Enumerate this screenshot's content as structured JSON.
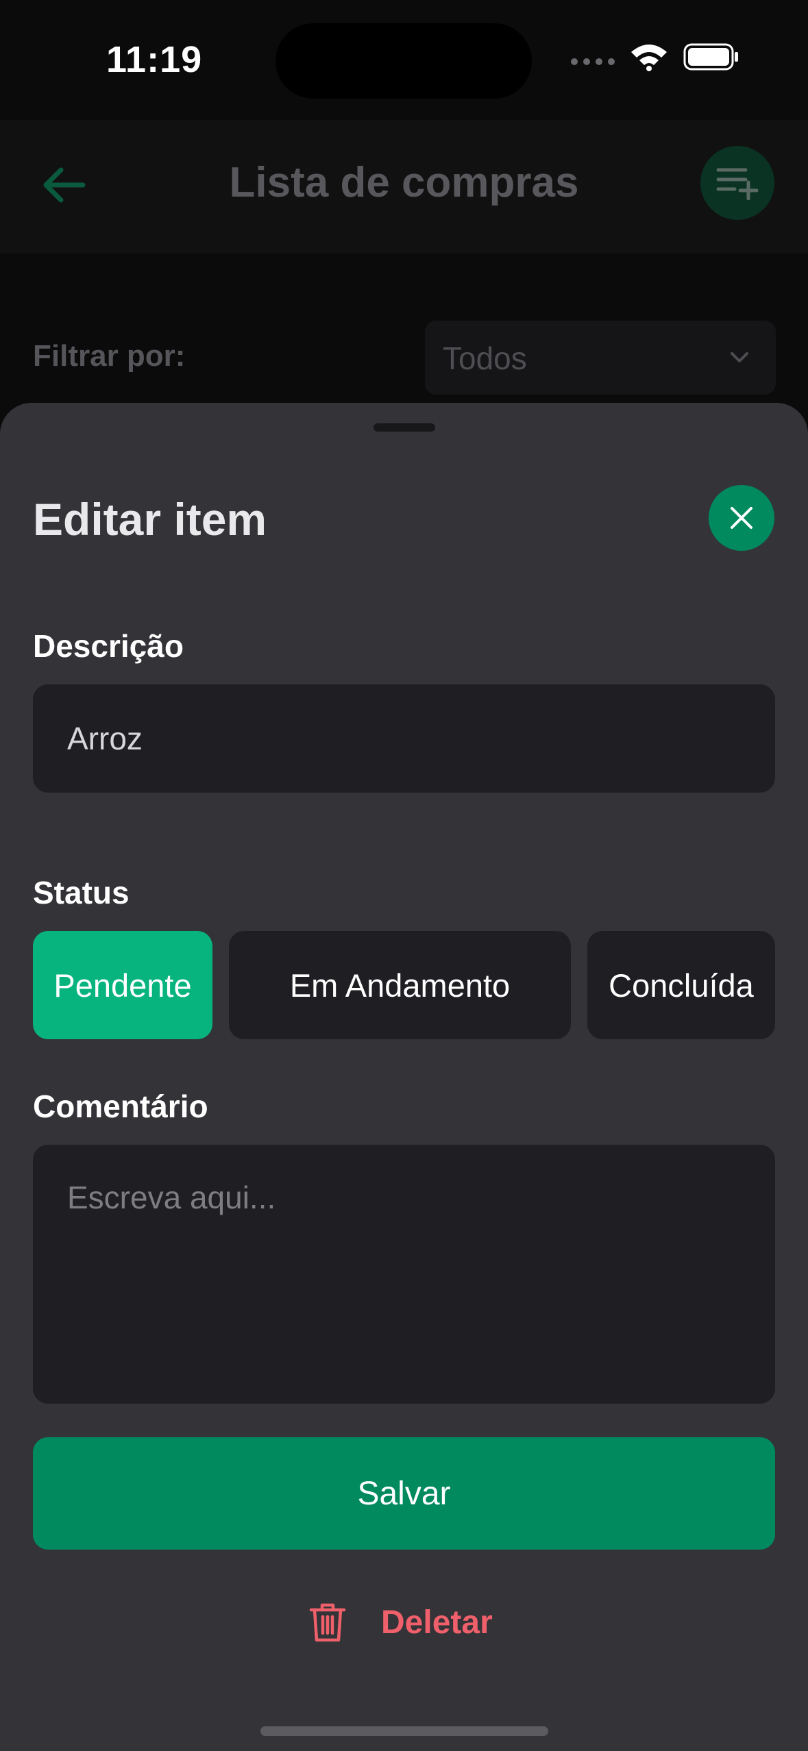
{
  "status_bar": {
    "time": "11:19"
  },
  "header": {
    "title": "Lista de compras",
    "back_icon": "arrow-left-icon",
    "action_icon": "playlist-add-icon"
  },
  "filter": {
    "label": "Filtrar por:",
    "selected": "Todos"
  },
  "sheet": {
    "title": "Editar item",
    "close_icon": "close-icon",
    "description": {
      "label": "Descrição",
      "value": "Arroz"
    },
    "status": {
      "label": "Status",
      "options": [
        "Pendente",
        "Em Andamento",
        "Concluída"
      ],
      "selected": "Pendente"
    },
    "comment": {
      "label": "Comentário",
      "placeholder": "Escreva aqui..."
    },
    "save_label": "Salvar",
    "delete_label": "Deletar",
    "delete_icon": "trash-icon"
  },
  "colors": {
    "accent": "#008a5e",
    "accent_active": "#08b47e",
    "danger": "#f0606b",
    "sheet_bg": "#333338",
    "input_bg": "#1f1e23"
  }
}
